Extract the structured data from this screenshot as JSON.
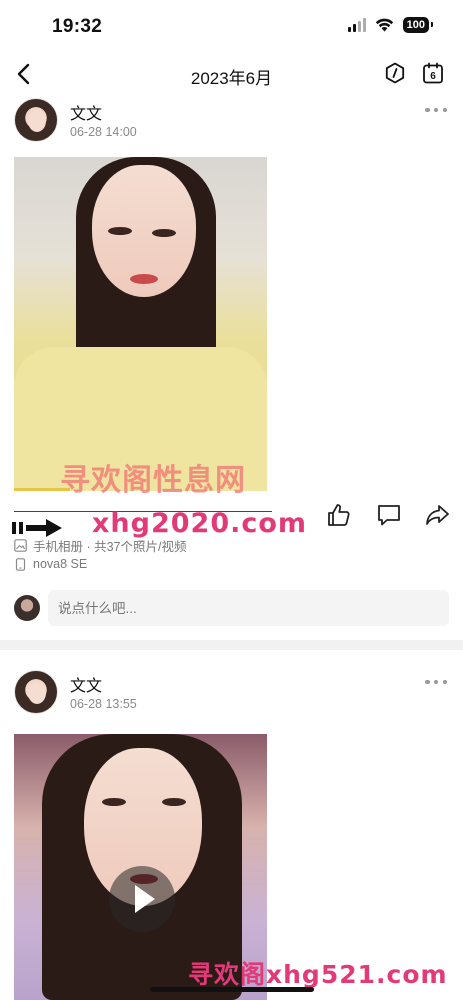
{
  "status_bar": {
    "time": "19:32",
    "battery": "100"
  },
  "nav": {
    "title": "2023年6月",
    "calendar_day": "6"
  },
  "posts": [
    {
      "author": "文文",
      "time": "06-28 14:00",
      "album_info": "手机相册 · 共37个照片/视频",
      "device": "nova8 SE",
      "comment_placeholder": "说点什么吧..."
    },
    {
      "author": "文文",
      "time": "06-28 13:55"
    }
  ],
  "watermarks": {
    "top_cn": "寻欢阁性息网",
    "mid_url": "xhg2020.com",
    "bottom": "寻欢阁xhg521.com"
  },
  "colors": {
    "watermark_pink": "#e23a78",
    "feed_divider": "#f1f1f1"
  }
}
